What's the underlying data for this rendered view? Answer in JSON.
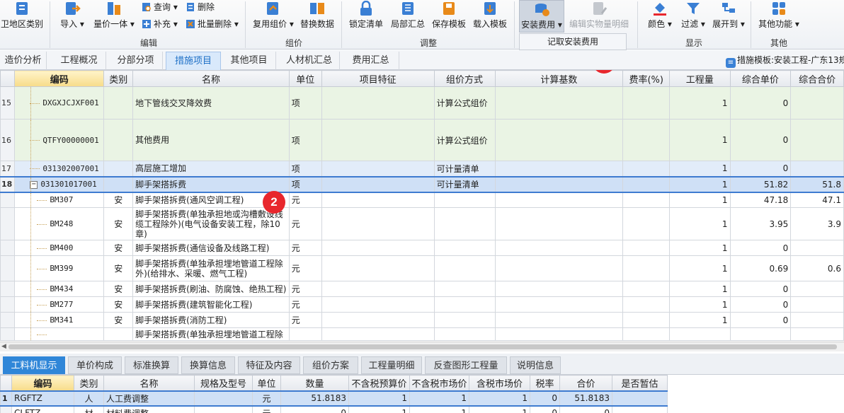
{
  "ribbon": {
    "region_label": "卫地区类别",
    "import": "导入",
    "unit_price_integration": "量价一体",
    "query": "查询",
    "supplement": "补充",
    "delete": "删除",
    "batch_delete": "批量删除",
    "reuse_pricing": "复用组价",
    "replace_data": "替换数据",
    "lock_bill": "锁定清单",
    "partial_summary": "局部汇总",
    "save_template": "保存模板",
    "load_template": "载入模板",
    "install_fee": "安装费用",
    "edit_quantity_detail": "编辑实物量明细",
    "color": "颜色",
    "filter": "过滤",
    "expand_to": "展开到",
    "other_functions": "其他功能",
    "groups": {
      "edit": "编辑",
      "pricing": "组价",
      "adjust": "调整",
      "display": "显示",
      "other": "其他"
    },
    "popup_item": "记取安装费用"
  },
  "tabs": [
    "造价分析",
    "工程概况",
    "分部分项",
    "措施项目",
    "其他项目",
    "人材机汇总",
    "费用汇总"
  ],
  "active_tab": "措施项目",
  "template_label": "措施模板:安装工程-广东13规",
  "grid": {
    "headers": [
      "编码",
      "类别",
      "名称",
      "单位",
      "项目特征",
      "组价方式",
      "计算基数",
      "费率(%)",
      "工程量",
      "综合单价",
      "综合合价"
    ],
    "rows": [
      {
        "rn": "15",
        "code": "DXGXJCJXF001",
        "cat": "",
        "name": "地下管线交叉降效费",
        "unit": "项",
        "feat": "",
        "method": "计算公式组价",
        "base": "",
        "rate": "",
        "qty": "1",
        "price": "0",
        "total": ""
      },
      {
        "rn": "16",
        "code": "QTFY00000001",
        "cat": "",
        "name": "其他费用",
        "unit": "项",
        "feat": "",
        "method": "计算公式组价",
        "base": "",
        "rate": "",
        "qty": "1",
        "price": "0",
        "total": ""
      },
      {
        "rn": "17",
        "code": "031302007001",
        "cat": "",
        "name": "高层施工增加",
        "unit": "项",
        "feat": "",
        "method": "可计量清单",
        "base": "",
        "rate": "",
        "qty": "1",
        "price": "0",
        "total": ""
      },
      {
        "rn": "18",
        "code": "031301017001",
        "cat": "",
        "name": "脚手架搭拆费",
        "unit": "项",
        "feat": "",
        "method": "可计量清单",
        "base": "",
        "rate": "",
        "qty": "1",
        "price": "51.82",
        "total": "51.8"
      },
      {
        "rn": "",
        "code": "BM307",
        "cat": "安",
        "name": "脚手架搭拆费(通风空调工程)",
        "unit": "元",
        "feat": "",
        "method": "",
        "base": "",
        "rate": "",
        "qty": "1",
        "price": "47.18",
        "total": "47.1"
      },
      {
        "rn": "",
        "code": "BM248",
        "cat": "安",
        "name": "脚手架搭拆费(单独承担地或沟槽敷设线缆工程除外)(电气设备安装工程，除10章)",
        "unit": "元",
        "feat": "",
        "method": "",
        "base": "",
        "rate": "",
        "qty": "1",
        "price": "3.95",
        "total": "3.9"
      },
      {
        "rn": "",
        "code": "BM400",
        "cat": "安",
        "name": "脚手架搭拆费(通信设备及线路工程)",
        "unit": "元",
        "feat": "",
        "method": "",
        "base": "",
        "rate": "",
        "qty": "1",
        "price": "0",
        "total": ""
      },
      {
        "rn": "",
        "code": "BM399",
        "cat": "安",
        "name": "脚手架搭拆费(单独承担埋地管道工程除外)(给排水、采暖、燃气工程)",
        "unit": "元",
        "feat": "",
        "method": "",
        "base": "",
        "rate": "",
        "qty": "1",
        "price": "0.69",
        "total": "0.6"
      },
      {
        "rn": "",
        "code": "BM434",
        "cat": "安",
        "name": "脚手架搭拆费(刷油、防腐蚀、绝热工程)",
        "unit": "元",
        "feat": "",
        "method": "",
        "base": "",
        "rate": "",
        "qty": "1",
        "price": "0",
        "total": ""
      },
      {
        "rn": "",
        "code": "BM277",
        "cat": "安",
        "name": "脚手架搭拆费(建筑智能化工程)",
        "unit": "元",
        "feat": "",
        "method": "",
        "base": "",
        "rate": "",
        "qty": "1",
        "price": "0",
        "total": ""
      },
      {
        "rn": "",
        "code": "BM341",
        "cat": "安",
        "name": "脚手架搭拆费(消防工程)",
        "unit": "元",
        "feat": "",
        "method": "",
        "base": "",
        "rate": "",
        "qty": "1",
        "price": "0",
        "total": ""
      },
      {
        "rn": "",
        "code": "",
        "cat": "",
        "name": "脚手架搭拆费(单独承担埋地管道工程除",
        "unit": "",
        "feat": "",
        "method": "",
        "base": "",
        "rate": "",
        "qty": "",
        "price": "",
        "total": ""
      }
    ]
  },
  "bottom_tabs": [
    "工料机显示",
    "单价构成",
    "标准换算",
    "换算信息",
    "特征及内容",
    "组价方案",
    "工程量明细",
    "反查图形工程量",
    "说明信息"
  ],
  "active_bottom_tab": "工料机显示",
  "bottom_grid": {
    "headers": [
      "编码",
      "类别",
      "名称",
      "规格及型号",
      "单位",
      "数量",
      "不含税预算价",
      "不含税市场价",
      "含税市场价",
      "税率",
      "合价",
      "是否暂估"
    ],
    "rows": [
      {
        "rn": "1",
        "code": "RGFTZ",
        "cat": "人",
        "name": "人工费调整",
        "spec": "",
        "unit": "元",
        "qty": "51.8183",
        "p1": "1",
        "p2": "1",
        "p3": "1",
        "tax": "0",
        "total": "51.8183",
        "est": ""
      },
      {
        "rn": "",
        "code": "CLFTZ",
        "cat": "材",
        "name": "材料费调整",
        "spec": "",
        "unit": "元",
        "qty": "0",
        "p1": "1",
        "p2": "1",
        "p3": "1",
        "tax": "0",
        "total": "0",
        "est": ""
      }
    ]
  },
  "callouts": [
    "1",
    "2"
  ],
  "colors": {
    "accent": "#2f86d8",
    "selected_row": "#cfe0f6",
    "green_row": "#eaf4e4",
    "callout_red": "#e8272d"
  }
}
